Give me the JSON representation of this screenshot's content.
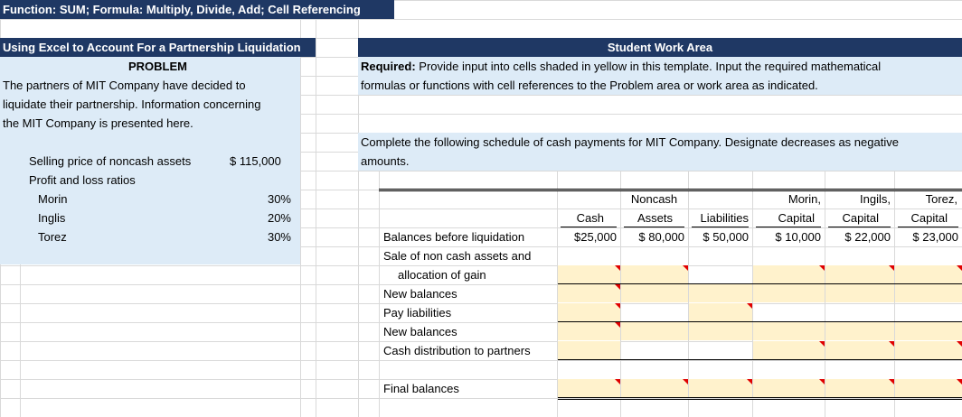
{
  "title": "Function: SUM; Formula: Multiply, Divide, Add; Cell Referencing",
  "left": {
    "header": "Using Excel to Account For a Partnership Liquidation",
    "problem": "PROBLEM",
    "desc_lines": [
      "The partners of MIT Company have decided to",
      "liquidate their partnership. Information concerning",
      "the MIT Company is presented here."
    ],
    "selling_label": "Selling price of noncash assets",
    "selling_value": "$ 115,000",
    "ratios_label": "Profit and loss ratios",
    "partners": [
      {
        "name": "Morin",
        "ratio": "30%"
      },
      {
        "name": "Inglis",
        "ratio": "20%"
      },
      {
        "name": "Torez",
        "ratio": "30%"
      }
    ]
  },
  "right": {
    "header": "Student Work Area",
    "required_bold": "Required:",
    "required_line1": " Provide input into cells shaded in yellow in this template. Input the required mathematical",
    "required_line2": "formulas or functions with cell references to the Problem area or work area as indicated.",
    "instr_line1": "Complete the following schedule of cash payments for MIT Company. Designate decreases as negative",
    "instr_line2": "amounts."
  },
  "schedule": {
    "headers_top": [
      "",
      "Noncash",
      "",
      "Morin,",
      "Ingils,",
      "Torez,"
    ],
    "headers_bottom": [
      "Cash",
      "Assets",
      "Liabilities",
      "Capital",
      "Capital",
      "Capital"
    ],
    "rows": [
      {
        "label": "Balances before liquidation",
        "values": [
          "$25,000",
          "$  80,000",
          "$  50,000",
          "$  10,000",
          "$  22,000",
          "$  23,000"
        ]
      },
      {
        "label": "Sale of non cash assets and",
        "values": []
      },
      {
        "label": "allocation of gain",
        "values": []
      },
      {
        "label": "New balances",
        "values": []
      },
      {
        "label": "Pay liabilities",
        "values": []
      },
      {
        "label": "New balances",
        "values": []
      },
      {
        "label": "Cash distribution to partners",
        "values": []
      },
      {
        "label": "",
        "values": []
      },
      {
        "label": "Final balances",
        "values": []
      }
    ]
  }
}
